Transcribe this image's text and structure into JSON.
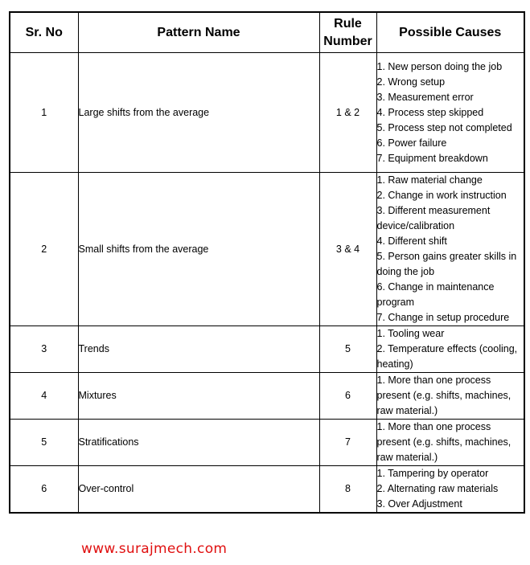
{
  "table": {
    "headers": [
      "Sr. No",
      "Pattern Name",
      "Rule\nNumber",
      "Possible Causes"
    ],
    "header_rule_line1": "Rule",
    "header_rule_line2": "Number",
    "rows": [
      {
        "sr": "1",
        "pattern": "Large shifts from the average",
        "rule": "1 & 2",
        "causes": [
          "1. New person doing the job",
          "2. Wrong setup",
          "3. Measurement error",
          "4. Process step skipped",
          "5. Process step not completed",
          "6. Power failure",
          "7. Equipment breakdown"
        ]
      },
      {
        "sr": "2",
        "pattern": "Small shifts from the average",
        "rule": "3 & 4",
        "causes": [
          "1. Raw material change",
          "2. Change in work instruction",
          "3. Different measurement device/calibration",
          "4. Different shift",
          "5. Person gains greater skills in doing the job",
          "6. Change in maintenance program",
          "7. Change in setup procedure"
        ]
      },
      {
        "sr": "3",
        "pattern": "Trends",
        "rule": "5",
        "causes": [
          "1. Tooling wear",
          "2. Temperature effects (cooling, heating)"
        ]
      },
      {
        "sr": "4",
        "pattern": "Mixtures",
        "rule": "6",
        "causes": [
          "1. More than one process present (e.g. shifts, machines, raw material.)"
        ]
      },
      {
        "sr": "5",
        "pattern": "Stratifications",
        "rule": "7",
        "causes": [
          "1. More than one process present (e.g. shifts, machines, raw material.)"
        ]
      },
      {
        "sr": "6",
        "pattern": "Over-control",
        "rule": "8",
        "causes": [
          "1. Tampering by operator",
          "2. Alternating raw materials",
          "3. Over Adjustment"
        ]
      }
    ]
  },
  "footer": {
    "website": "www.surajmech.com",
    "color": "#e01010"
  }
}
